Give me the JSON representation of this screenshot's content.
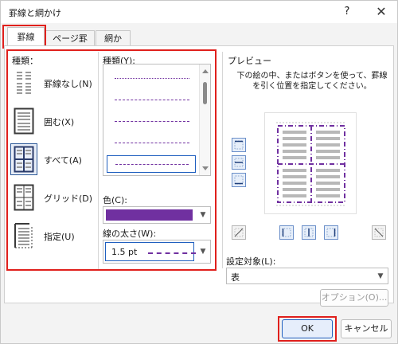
{
  "window": {
    "title": "罫線と網かけ",
    "help": "?",
    "close": "✕"
  },
  "tabs": [
    {
      "label": "罫線"
    },
    {
      "label": "ページ罫線"
    },
    {
      "label": "網かけ"
    }
  ],
  "settings": {
    "heading": "種類：",
    "items": [
      {
        "label": "罫線なし(N)"
      },
      {
        "label": "囲む(X)"
      },
      {
        "label": "すべて(A)"
      },
      {
        "label": "グリッド(D)"
      },
      {
        "label": "指定(U)"
      }
    ],
    "selected_index": 2
  },
  "style": {
    "heading": "種類(Y):",
    "line_color": "#7030a0",
    "selected_index": 4
  },
  "color": {
    "label": "色(C):",
    "value": "#7030a0"
  },
  "width": {
    "label": "線の太さ(W):",
    "value": "1.5 pt"
  },
  "preview": {
    "heading": "プレビュー",
    "description": "下の絵の中、またはボタンを使って、罫線を引く位置を指定してください。"
  },
  "apply_to": {
    "label": "設定対象(L):",
    "value": "表"
  },
  "buttons": {
    "options": "オプション(O)...",
    "ok": "OK",
    "cancel": "キャンセル"
  }
}
